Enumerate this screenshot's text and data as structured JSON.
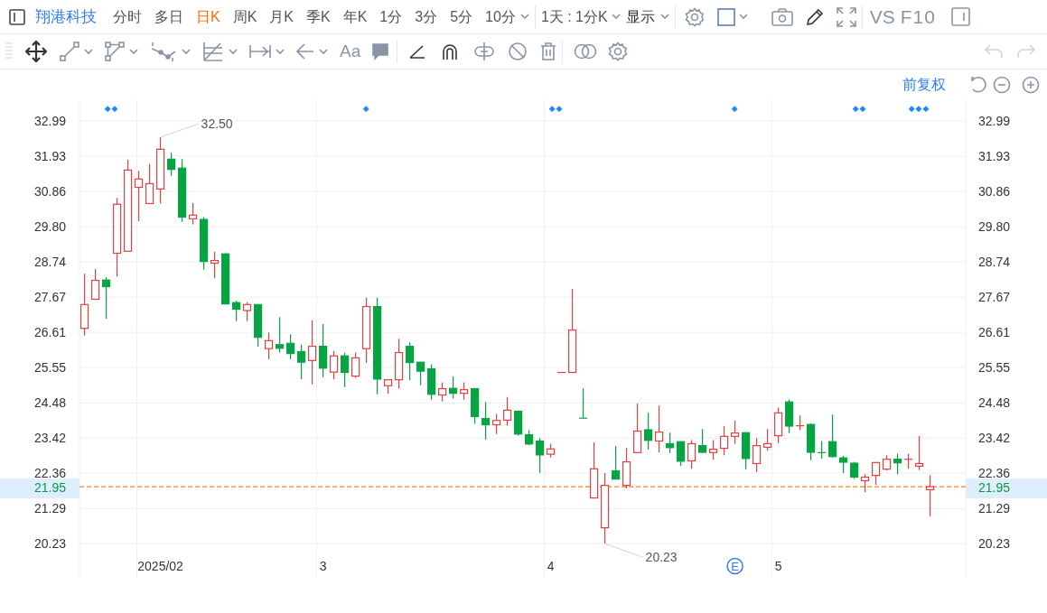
{
  "toolbar": {
    "stock_name": "翔港科技",
    "periods": [
      {
        "label": "分时",
        "selected": false,
        "has_menu": false
      },
      {
        "label": "多日",
        "selected": false,
        "has_menu": false
      },
      {
        "label": "日K",
        "selected": true,
        "has_menu": false
      },
      {
        "label": "周K",
        "selected": false,
        "has_menu": false
      },
      {
        "label": "月K",
        "selected": false,
        "has_menu": false
      },
      {
        "label": "季K",
        "selected": false,
        "has_menu": false
      },
      {
        "label": "年K",
        "selected": false,
        "has_menu": false
      },
      {
        "label": "1分",
        "selected": false,
        "has_menu": false
      },
      {
        "label": "3分",
        "selected": false,
        "has_menu": false
      },
      {
        "label": "5分",
        "selected": false,
        "has_menu": false
      },
      {
        "label": "10分",
        "selected": false,
        "has_menu": true
      }
    ],
    "interval": "1天 : 1分K",
    "display": "显示",
    "compare": "VS",
    "f10": "F10"
  },
  "drawing_toolbar": {
    "text_tool": "Aa",
    "undo": {
      "disabled": true
    },
    "redo": {
      "disabled": true
    }
  },
  "adjust_mode": "前复权",
  "chart": {
    "chart_data": {
      "type": "candlestick",
      "ylim": [
        19.2,
        33.62
      ],
      "yticks": [
        {
          "value": 32.99,
          "label": "32.99"
        },
        {
          "value": 31.93,
          "label": "31.93"
        },
        {
          "value": 30.86,
          "label": "30.86"
        },
        {
          "value": 29.8,
          "label": "29.80"
        },
        {
          "value": 28.74,
          "label": "28.74"
        },
        {
          "value": 27.67,
          "label": "27.67"
        },
        {
          "value": 26.61,
          "label": "26.61"
        },
        {
          "value": 25.55,
          "label": "25.55"
        },
        {
          "value": 24.48,
          "label": "24.48"
        },
        {
          "value": 23.42,
          "label": "23.42"
        },
        {
          "value": 22.36,
          "label": "22.36"
        },
        {
          "value": 21.29,
          "label": "21.29"
        },
        {
          "value": 20.23,
          "label": "20.23"
        }
      ],
      "grid": true,
      "categories": [
        null,
        null,
        null,
        null,
        null,
        null,
        null,
        "2025/02",
        null,
        null,
        null,
        null,
        null,
        null,
        null,
        null,
        null,
        null,
        null,
        null,
        null,
        null,
        "3",
        null,
        null,
        null,
        null,
        null,
        null,
        null,
        null,
        null,
        null,
        null,
        null,
        null,
        null,
        null,
        null,
        null,
        null,
        null,
        null,
        "4",
        null,
        null,
        null,
        null,
        null,
        null,
        null,
        null,
        null,
        null,
        null,
        null,
        null,
        null,
        null,
        null,
        null,
        null,
        null,
        null,
        "5",
        null,
        null,
        null,
        null,
        null,
        null,
        null,
        null,
        null,
        null,
        null,
        null,
        null,
        null
      ],
      "ohlc": [
        [
          26.73,
          28.38,
          26.52,
          27.45
        ],
        [
          27.61,
          28.52,
          27.61,
          28.18
        ],
        [
          28.19,
          28.28,
          27.02,
          27.99
        ],
        [
          29.0,
          30.67,
          28.29,
          30.48
        ],
        [
          29.06,
          31.82,
          29.06,
          31.51
        ],
        [
          30.99,
          31.49,
          29.97,
          31.24
        ],
        [
          30.5,
          31.69,
          30.5,
          31.1
        ],
        [
          30.94,
          32.5,
          30.5,
          32.14
        ],
        [
          31.84,
          32.03,
          31.34,
          31.53
        ],
        [
          31.57,
          31.84,
          29.95,
          30.09
        ],
        [
          30.04,
          30.51,
          29.87,
          30.15
        ],
        [
          30.02,
          30.09,
          28.5,
          28.75
        ],
        [
          28.7,
          29.04,
          28.24,
          28.78
        ],
        [
          28.98,
          29.0,
          27.45,
          27.47
        ],
        [
          27.51,
          27.56,
          26.95,
          27.31
        ],
        [
          27.27,
          27.52,
          26.95,
          27.45
        ],
        [
          27.45,
          27.46,
          26.18,
          26.46
        ],
        [
          26.12,
          26.61,
          25.8,
          26.36
        ],
        [
          26.24,
          27.07,
          26.0,
          26.13
        ],
        [
          26.28,
          26.55,
          25.8,
          25.97
        ],
        [
          26.03,
          26.24,
          25.2,
          25.71
        ],
        [
          25.76,
          26.97,
          25.04,
          26.19
        ],
        [
          26.19,
          26.86,
          25.26,
          25.53
        ],
        [
          25.41,
          26.05,
          25.2,
          25.9
        ],
        [
          25.9,
          26.0,
          24.96,
          25.4
        ],
        [
          25.29,
          26.0,
          25.24,
          25.84
        ],
        [
          26.12,
          27.66,
          25.69,
          27.39
        ],
        [
          27.39,
          27.66,
          24.74,
          25.2
        ],
        [
          25.0,
          25.2,
          24.76,
          25.18
        ],
        [
          25.18,
          26.42,
          24.91,
          26.0
        ],
        [
          26.19,
          26.31,
          25.17,
          25.7
        ],
        [
          25.71,
          25.71,
          25.01,
          25.44
        ],
        [
          25.51,
          25.65,
          24.58,
          24.74
        ],
        [
          24.72,
          25.1,
          24.52,
          24.91
        ],
        [
          24.92,
          25.28,
          24.61,
          24.77
        ],
        [
          24.77,
          25.1,
          24.58,
          24.88
        ],
        [
          24.91,
          24.93,
          23.85,
          24.07
        ],
        [
          24.01,
          24.51,
          23.37,
          23.82
        ],
        [
          23.82,
          24.15,
          23.54,
          23.95
        ],
        [
          23.96,
          24.66,
          23.79,
          24.26
        ],
        [
          24.23,
          24.25,
          23.49,
          23.54
        ],
        [
          23.52,
          23.66,
          23.21,
          23.24
        ],
        [
          23.33,
          23.42,
          22.37,
          22.91
        ],
        [
          22.93,
          23.25,
          22.83,
          23.09
        ],
        [
          25.4,
          25.4,
          25.4,
          25.4
        ],
        [
          25.4,
          27.92,
          25.4,
          26.68
        ],
        [
          24.02,
          24.92,
          24.02,
          24.02
        ],
        [
          21.61,
          23.29,
          21.61,
          22.49
        ],
        [
          20.71,
          22.36,
          20.23,
          21.99
        ],
        [
          22.43,
          23.18,
          22.18,
          22.18
        ],
        [
          21.99,
          23.12,
          21.9,
          22.7
        ],
        [
          22.98,
          24.46,
          22.98,
          23.63
        ],
        [
          23.67,
          24.18,
          23.07,
          23.35
        ],
        [
          23.33,
          24.4,
          22.99,
          23.6
        ],
        [
          23.25,
          23.58,
          22.97,
          23.13
        ],
        [
          23.31,
          23.31,
          22.58,
          22.72
        ],
        [
          22.73,
          23.36,
          22.49,
          23.25
        ],
        [
          23.19,
          23.69,
          22.97,
          22.99
        ],
        [
          22.98,
          23.36,
          22.77,
          23.08
        ],
        [
          23.11,
          23.78,
          22.9,
          23.47
        ],
        [
          23.47,
          23.94,
          23.24,
          23.57
        ],
        [
          23.58,
          23.6,
          22.48,
          22.8
        ],
        [
          22.65,
          23.42,
          22.39,
          23.19
        ],
        [
          23.14,
          23.69,
          23.04,
          23.25
        ],
        [
          23.49,
          24.34,
          23.27,
          24.18
        ],
        [
          24.51,
          24.58,
          23.57,
          23.78
        ],
        [
          23.79,
          24.1,
          23.66,
          23.79
        ],
        [
          23.83,
          23.86,
          22.75,
          22.99
        ],
        [
          22.98,
          23.33,
          22.8,
          22.98
        ],
        [
          23.31,
          24.13,
          22.83,
          22.86
        ],
        [
          22.82,
          22.88,
          22.36,
          22.69
        ],
        [
          22.66,
          22.7,
          22.19,
          22.24
        ],
        [
          22.13,
          22.33,
          21.79,
          22.24
        ],
        [
          22.29,
          22.68,
          22.01,
          22.68
        ],
        [
          22.48,
          22.9,
          22.45,
          22.78
        ],
        [
          22.78,
          22.95,
          22.33,
          22.67
        ],
        [
          22.78,
          22.95,
          22.49,
          22.78
        ],
        [
          22.57,
          23.48,
          22.45,
          22.65
        ],
        [
          21.86,
          22.3,
          21.06,
          21.95
        ]
      ],
      "annotations": [
        "◆◆",
        "◆",
        "◆◆",
        "◆",
        "◆◆",
        "◆◆◆",
        "32.50",
        "20.23",
        "E",
        "21.95"
      ],
      "ref_lines": [
        {
          "axis": "y",
          "value": 21.95,
          "label": "21.95"
        }
      ]
    }
  }
}
